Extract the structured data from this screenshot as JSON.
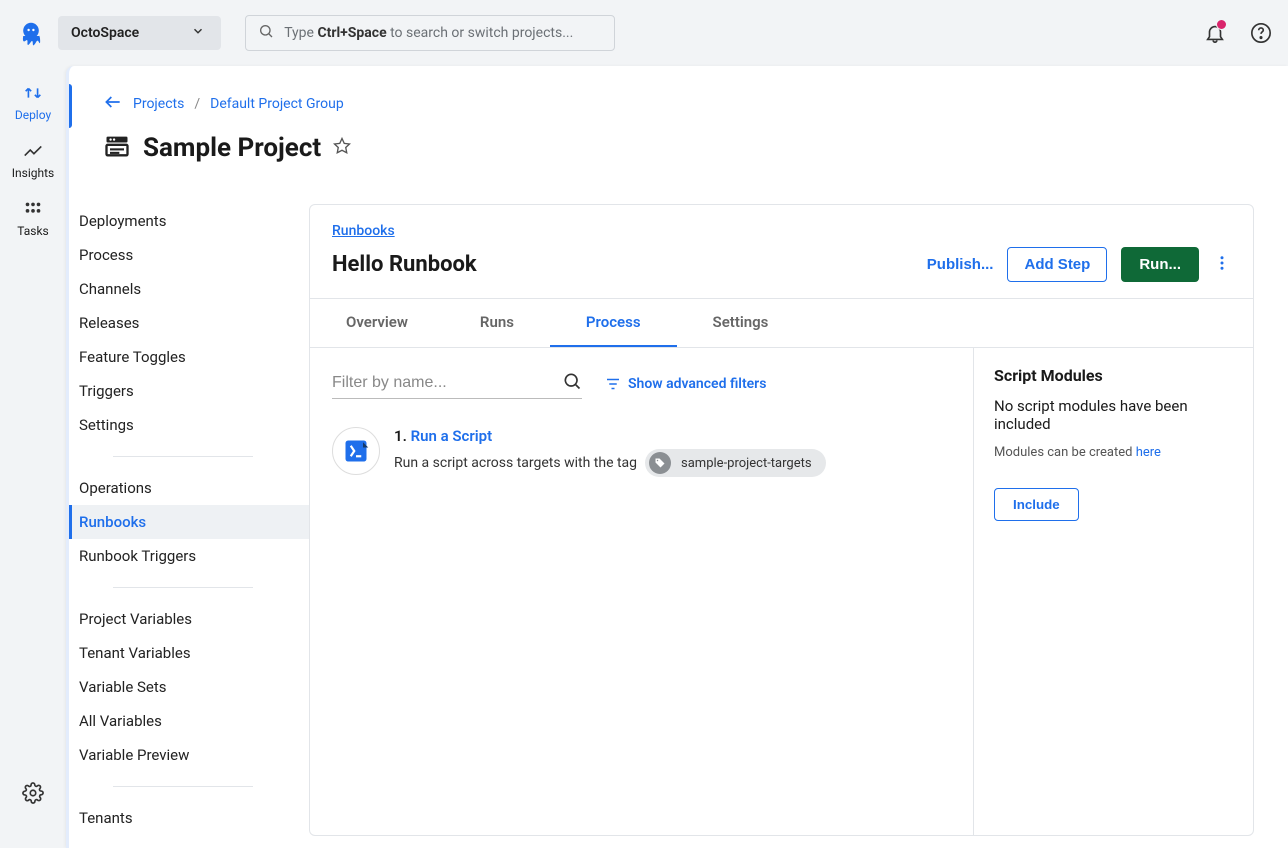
{
  "topbar": {
    "space_name": "OctoSpace",
    "search_prefix": "Type ",
    "search_shortcut": "Ctrl+Space",
    "search_suffix": " to search or switch projects..."
  },
  "rail": {
    "items": [
      {
        "label": "Deploy"
      },
      {
        "label": "Insights"
      },
      {
        "label": "Tasks"
      }
    ]
  },
  "breadcrumb": {
    "level1": "Projects",
    "sep": "/",
    "level2": "Default Project Group"
  },
  "page": {
    "title": "Sample Project"
  },
  "sidenav": {
    "group1": [
      "Deployments",
      "Process",
      "Channels",
      "Releases",
      "Feature Toggles",
      "Triggers",
      "Settings"
    ],
    "group2": [
      "Operations",
      "Runbooks",
      "Runbook Triggers"
    ],
    "group3": [
      "Project Variables",
      "Tenant Variables",
      "Variable Sets",
      "All Variables",
      "Variable Preview"
    ],
    "group4": [
      "Tenants"
    ],
    "active": "Runbooks"
  },
  "card": {
    "crumb": "Runbooks",
    "title": "Hello Runbook",
    "actions": {
      "publish": "Publish...",
      "add_step": "Add Step",
      "run": "Run..."
    },
    "tabs": [
      "Overview",
      "Runs",
      "Process",
      "Settings"
    ],
    "active_tab": "Process",
    "filter_placeholder": "Filter by name...",
    "adv_filter_label": "Show advanced filters",
    "step": {
      "number": "1.",
      "name": "Run a Script",
      "desc_prefix": "Run a script across targets with the tag",
      "tag": "sample-project-targets"
    },
    "modules": {
      "title": "Script Modules",
      "no_modules": "No script modules have been included",
      "created_prefix": "Modules can be created ",
      "created_link": "here",
      "include_label": "Include"
    }
  }
}
